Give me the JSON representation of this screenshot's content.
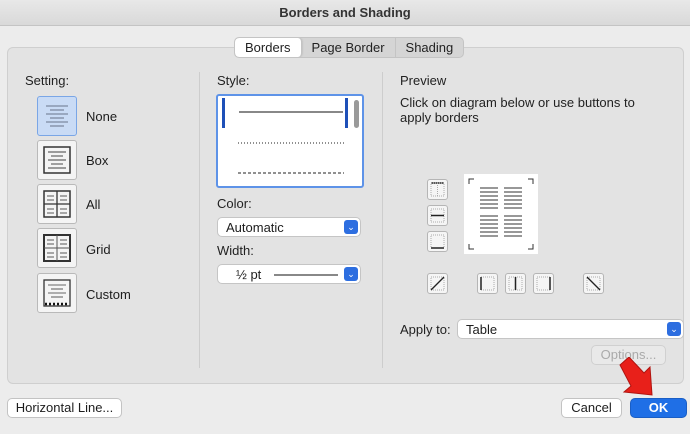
{
  "window": {
    "title": "Borders and Shading"
  },
  "tabs": [
    {
      "label": "Borders",
      "active": true
    },
    {
      "label": "Page Border",
      "active": false
    },
    {
      "label": "Shading",
      "active": false
    }
  ],
  "setting": {
    "label": "Setting:",
    "options": [
      {
        "label": "None",
        "selected": true
      },
      {
        "label": "Box",
        "selected": false
      },
      {
        "label": "All",
        "selected": false
      },
      {
        "label": "Grid",
        "selected": false
      },
      {
        "label": "Custom",
        "selected": false
      }
    ]
  },
  "style": {
    "label": "Style:",
    "options": [
      "solid",
      "dotted",
      "dashed"
    ],
    "selected": "solid"
  },
  "color": {
    "label": "Color:",
    "value": "Automatic"
  },
  "width": {
    "label": "Width:",
    "value": "½ pt"
  },
  "preview": {
    "label": "Preview",
    "instructions": "Click on diagram below or use buttons to apply borders"
  },
  "apply_to": {
    "label": "Apply to:",
    "value": "Table"
  },
  "buttons": {
    "options": "Options...",
    "horizontal_line": "Horizontal Line...",
    "cancel": "Cancel",
    "ok": "OK"
  },
  "colors": {
    "accent": "#1f6fe6",
    "annotation_arrow": "#e8201a"
  }
}
